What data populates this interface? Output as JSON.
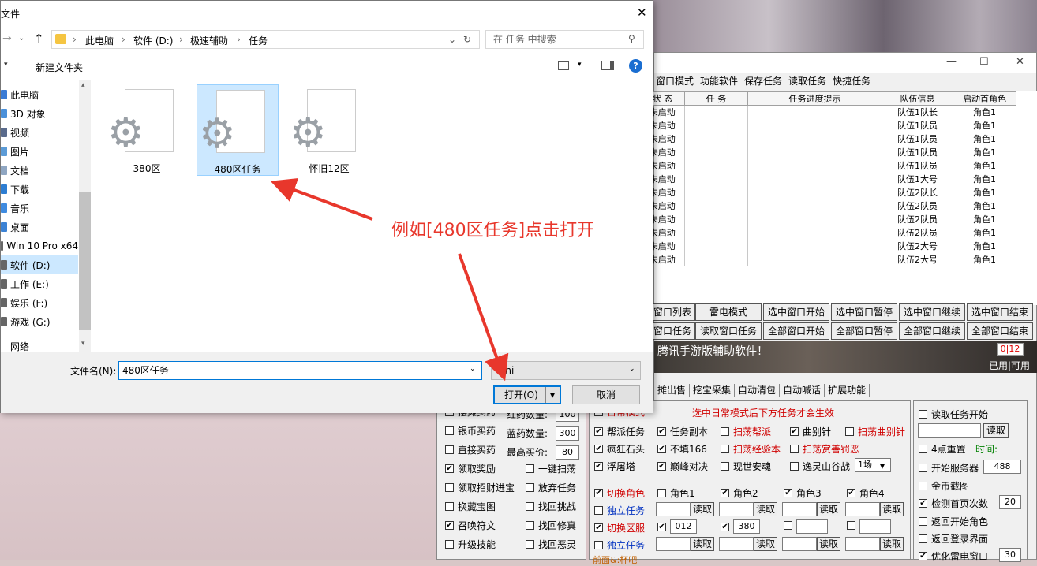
{
  "dialog": {
    "title": "文件",
    "address": [
      "此电脑",
      "软件 (D:)",
      "极速辅助",
      "任务"
    ],
    "search_placeholder": "在 任务 中搜索",
    "new_folder": "新建文件夹",
    "nav_items": [
      {
        "label": "此电脑",
        "color": "#3a7bd5"
      },
      {
        "label": "3D 对象",
        "color": "#4a90d9"
      },
      {
        "label": "视频",
        "color": "#5a6b8c"
      },
      {
        "label": "图片",
        "color": "#5c9bd6"
      },
      {
        "label": "文档",
        "color": "#8fa6c2"
      },
      {
        "label": "下载",
        "color": "#2d7dd2"
      },
      {
        "label": "音乐",
        "color": "#3f8be0"
      },
      {
        "label": "桌面",
        "color": "#3c82d4"
      },
      {
        "label": "Win 10 Pro x64",
        "color": "#666666"
      },
      {
        "label": "软件 (D:)",
        "color": "#666666"
      },
      {
        "label": "工作 (E:)",
        "color": "#666666"
      },
      {
        "label": "娱乐 (F:)",
        "color": "#666666"
      },
      {
        "label": "游戏 (G:)",
        "color": "#666666"
      },
      {
        "label": "网络",
        "color": "#ffffff"
      }
    ],
    "files": [
      {
        "name": "380区",
        "selected": false
      },
      {
        "name": "480区任务",
        "selected": true
      },
      {
        "name": "怀旧12区",
        "selected": false
      }
    ],
    "filename_label": "文件名(N):",
    "filename_value": "480区任务",
    "filetype_value": "ini",
    "open_button": "打开(O)",
    "cancel_button": "取消"
  },
  "annotation": {
    "text": "例如[480区任务]点击打开",
    "color": "#e8372c"
  },
  "app": {
    "menu": [
      "窗口模式",
      "功能软件",
      "保存任务",
      "读取任务",
      "快捷任务"
    ],
    "columns": [
      "状 态",
      "任 务",
      "任务进度提示",
      "队伍信息",
      "启动首角色"
    ],
    "rows": [
      {
        "status": "未启动",
        "team": "队伍1队长",
        "role": "角色1"
      },
      {
        "status": "未启动",
        "team": "队伍1队员",
        "role": "角色1"
      },
      {
        "status": "未启动",
        "team": "队伍1队员",
        "role": "角色1"
      },
      {
        "status": "未启动",
        "team": "队伍1队员",
        "role": "角色1"
      },
      {
        "status": "未启动",
        "team": "队伍1队员",
        "role": "角色1"
      },
      {
        "status": "未启动",
        "team": "队伍1大号",
        "role": "角色1"
      },
      {
        "status": "未启动",
        "team": "队伍2队长",
        "role": "角色1"
      },
      {
        "status": "未启动",
        "team": "队伍2队员",
        "role": "角色1"
      },
      {
        "status": "未启动",
        "team": "队伍2队员",
        "role": "角色1"
      },
      {
        "status": "未启动",
        "team": "队伍2队员",
        "role": "角色1"
      },
      {
        "status": "未启动",
        "team": "队伍2大号",
        "role": "角色1"
      },
      {
        "status": "未启动",
        "team": "队伍2大号",
        "role": "角色1"
      }
    ],
    "buttons_row1": [
      "窗口列表",
      "雷电模式",
      "选中窗口开始",
      "选中窗口暂停",
      "选中窗口继续",
      "选中窗口结束"
    ],
    "buttons_row2": [
      "窗口任务",
      "读取窗口任务",
      "全部窗口开始",
      "全部窗口暂停",
      "全部窗口继续",
      "全部窗口结束"
    ],
    "banner_text": "腾讯手游版辅助软件！",
    "counter": "0|12",
    "counter_label": "已用|可用",
    "tabs": [
      "摊出售",
      "挖宝采集",
      "自动清包",
      "自动喊话",
      "扩展功能"
    ],
    "left_panel": {
      "items": [
        {
          "label": "摆摊买药",
          "checked": false
        },
        {
          "label": "银币买药",
          "checked": false
        },
        {
          "label": "直接买药",
          "checked": false
        },
        {
          "label": "领取奖励",
          "checked": true
        },
        {
          "label": "领取招财进宝",
          "checked": false
        },
        {
          "label": "换藏宝图",
          "checked": false
        },
        {
          "label": "召唤符文",
          "checked": true
        },
        {
          "label": "升级技能",
          "checked": false
        }
      ],
      "fields": [
        {
          "label": "红药数量:",
          "value": "100"
        },
        {
          "label": "蓝药数量:",
          "value": "300"
        },
        {
          "label": "最高买价:",
          "value": "80"
        }
      ],
      "right_items": [
        {
          "label": "一键扫荡",
          "checked": false
        },
        {
          "label": "放弃任务",
          "checked": false
        },
        {
          "label": "找回挑战",
          "checked": false
        },
        {
          "label": "找回修真",
          "checked": false
        },
        {
          "label": "找回恶灵",
          "checked": false
        }
      ]
    },
    "mid_panel": {
      "header_check": "日常模式",
      "header_note": "选中日常模式后下方任务才会生效",
      "tasks": [
        {
          "label": "帮派任务",
          "checked": true,
          "red": false
        },
        {
          "label": "任务副本",
          "checked": true,
          "red": false
        },
        {
          "label": "扫荡帮派",
          "checked": false,
          "red": true
        },
        {
          "label": "曲别针",
          "checked": true,
          "red": false
        },
        {
          "label": "扫荡曲别针",
          "checked": false,
          "red": true
        },
        {
          "label": "疯狂石头",
          "checked": true,
          "red": false
        },
        {
          "label": "不填166",
          "checked": true,
          "red": false
        },
        {
          "label": "扫荡经验本",
          "checked": false,
          "red": true
        },
        {
          "label": "扫荡赏善罚恶",
          "checked": false,
          "red": true
        },
        {
          "label": "浮屠塔",
          "checked": true,
          "red": false
        },
        {
          "label": "巅峰对决",
          "checked": true,
          "red": false
        },
        {
          "label": "现世安魂",
          "checked": false,
          "red": false
        },
        {
          "label": "逸灵山谷战",
          "checked": false,
          "red": false
        }
      ],
      "battle_select": "1场",
      "switch_role": "切换角色",
      "roles": [
        "角色1",
        "角色2",
        "角色3",
        "角色4"
      ],
      "solo_task": "独立任务",
      "read": "读取",
      "switch_server": "切换区服",
      "server1": "012",
      "server2": "380",
      "footer_partial": "前面&:杯吧"
    },
    "right_panel": {
      "read_task_start": "读取任务开始",
      "read_btn": "读取",
      "reset_4": "4点重置",
      "time_label": "时间:",
      "start_server": "开始服务器",
      "start_server_value": "488",
      "gold_screenshot": "金币截图",
      "check_first_page": "检测首页次数",
      "check_value": "20",
      "return_start_role": "返回开始角色",
      "return_login": "返回登录界面",
      "optimize": "优化雷电窗口",
      "optimize_value": "30"
    }
  }
}
